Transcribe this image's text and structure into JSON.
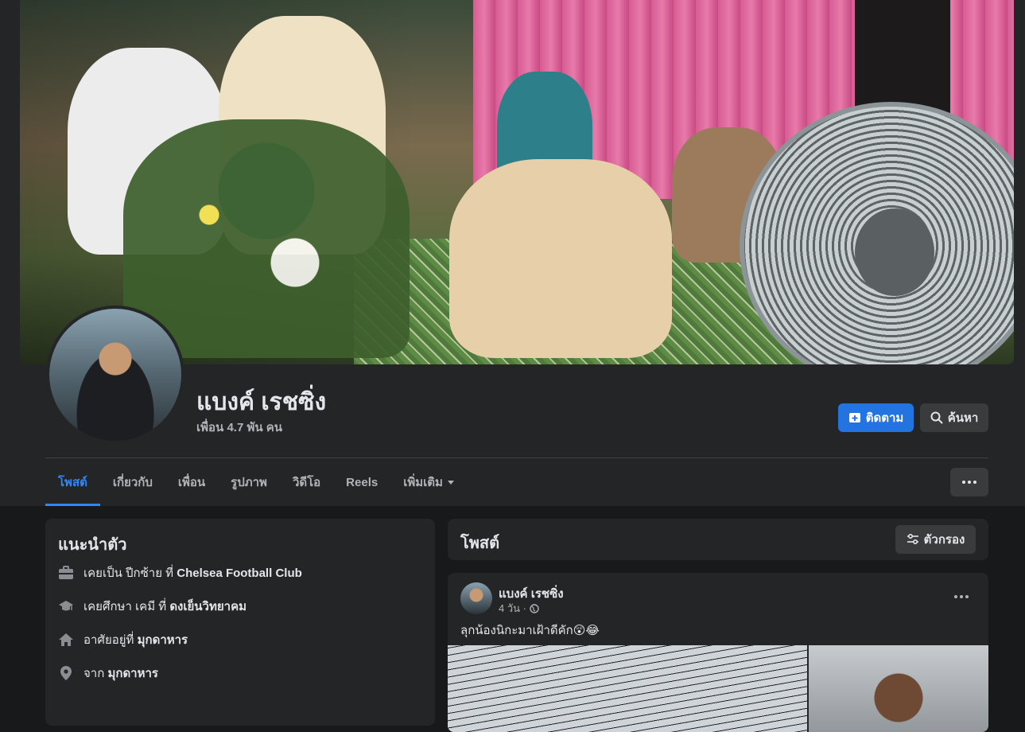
{
  "profile": {
    "name": "แบงค์ เรชซิ่ง",
    "friends": "เพื่อน 4.7 พัน คน"
  },
  "actions": {
    "follow_label": "ติดตาม",
    "search_label": "ค้นหา"
  },
  "tabs": [
    {
      "label": "โพสต์",
      "active": true
    },
    {
      "label": "เกี่ยวกับ"
    },
    {
      "label": "เพื่อน"
    },
    {
      "label": "รูปภาพ"
    },
    {
      "label": "วิดีโอ"
    },
    {
      "label": "Reels"
    },
    {
      "label": "เพิ่มเติม"
    }
  ],
  "intro": {
    "title": "แนะนำตัว",
    "items": [
      {
        "icon": "briefcase-icon",
        "prefix": "เคยเป็น ปีกซ้าย ที่",
        "bold": "Chelsea Football Club"
      },
      {
        "icon": "graduation-cap-icon",
        "prefix": "เคยศึกษา เคมี ที่",
        "bold": "ดงเย็นวิทยาคม"
      },
      {
        "icon": "home-icon",
        "prefix": "อาศัยอยู่ที่",
        "bold": "มุกดาหาร"
      },
      {
        "icon": "location-pin-icon",
        "prefix": "จาก",
        "bold": "มุกดาหาร"
      }
    ]
  },
  "posts": {
    "title": "โพสต์",
    "filter_label": "ตัวกรอง",
    "first": {
      "author": "แบงค์ เรชซิ่ง",
      "time": "4 วัน ·",
      "privacy_icon": "globe-icon",
      "text": "ลุกน้องนิกะมาเฝ้าดีคัก😲😂"
    }
  },
  "colors": {
    "accent": "#2374e1",
    "active_tab": "#2d88ff",
    "background": "#18191a",
    "card": "#242526",
    "button": "#3a3b3c"
  }
}
